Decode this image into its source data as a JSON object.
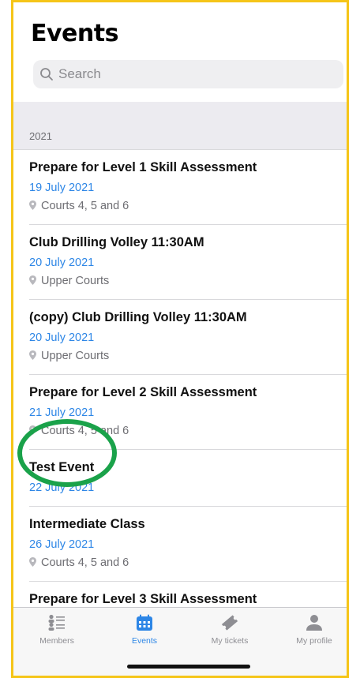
{
  "header": {
    "title": "Events",
    "search_placeholder": "Search"
  },
  "section": {
    "year": "2021"
  },
  "events": [
    {
      "name": "Prepare for Level 1 Skill Assessment",
      "date": "19 July 2021",
      "location": "Courts 4, 5 and 6"
    },
    {
      "name": "Club Drilling Volley 11:30AM",
      "date": "20 July 2021",
      "location": "Upper Courts"
    },
    {
      "name": "(copy) Club Drilling Volley 11:30AM",
      "date": "20 July 2021",
      "location": "Upper Courts"
    },
    {
      "name": "Prepare for Level 2 Skill Assessment",
      "date": "21 July 2021",
      "location": "Courts 4, 5 and 6"
    },
    {
      "name": "Test Event",
      "date": "22 July 2021",
      "location": ""
    },
    {
      "name": "Intermediate Class",
      "date": "26 July 2021",
      "location": "Courts 4, 5 and 6"
    },
    {
      "name": "Prepare for Level 3 Skill Assessment",
      "date": "",
      "location": ""
    }
  ],
  "tabs": [
    {
      "label": "Members",
      "icon": "members-icon",
      "active": false
    },
    {
      "label": "Events",
      "icon": "calendar-icon",
      "active": true
    },
    {
      "label": "My tickets",
      "icon": "ticket-icon",
      "active": false
    },
    {
      "label": "My profile",
      "icon": "profile-icon",
      "active": false
    }
  ],
  "colors": {
    "accent": "#2d86e6",
    "highlight_circle": "#1aa24a",
    "frame_border": "#f5c518"
  }
}
